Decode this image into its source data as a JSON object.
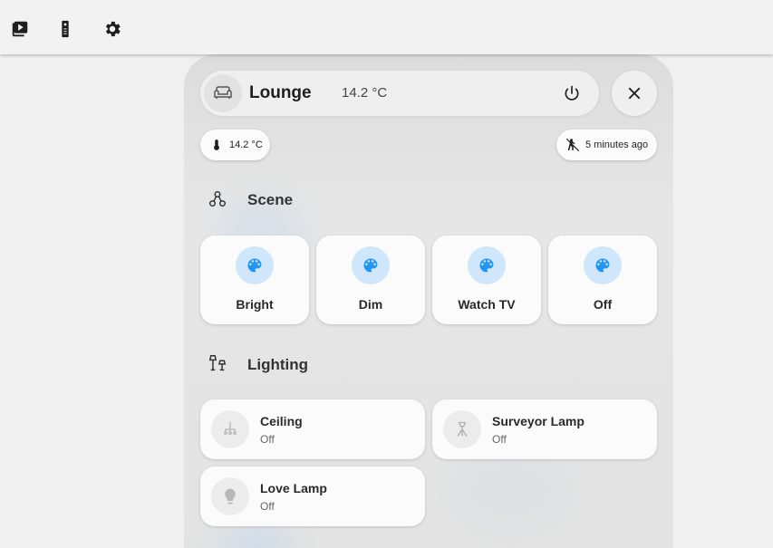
{
  "toolbar": {
    "icons": [
      "media-library-icon",
      "remote-control-icon",
      "settings-gear-icon"
    ]
  },
  "room": {
    "name": "Lounge",
    "temperature": "14.2 °C"
  },
  "chips": {
    "temperature": "14.2 °C",
    "motion": "5 minutes ago"
  },
  "sections": {
    "scene": "Scene",
    "lighting": "Lighting"
  },
  "scenes": [
    {
      "label": "Bright"
    },
    {
      "label": "Dim"
    },
    {
      "label": "Watch TV"
    },
    {
      "label": "Off"
    }
  ],
  "lights": [
    {
      "name": "Ceiling",
      "state": "Off"
    },
    {
      "name": "Surveyor Lamp",
      "state": "Off"
    },
    {
      "name": "Love Lamp",
      "state": "Off"
    }
  ],
  "colors": {
    "accent": "#2196f3",
    "accent_light": "#cfe6fb",
    "card": "#fbfbfb",
    "background": "#f0f0f0"
  }
}
